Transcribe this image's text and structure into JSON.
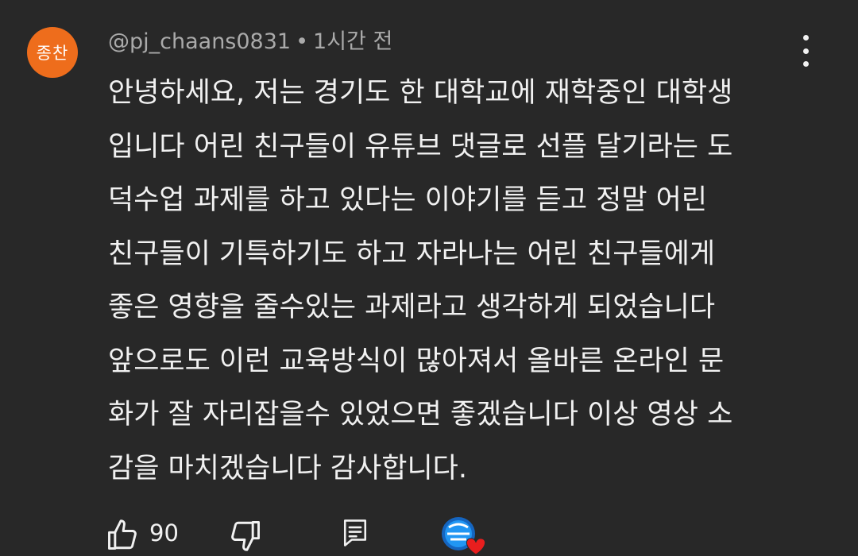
{
  "comment": {
    "avatar_text": "종찬",
    "author": "@pj_chaans0831",
    "separator": "•",
    "time": "1시간 전",
    "lines": [
      "안녕하세요, 저는 경기도 한 대학교에 재학중인 대학생",
      "입니다 어린 친구들이 유튜브 댓글로 선플 달기라는 도",
      "덕수업 과제를 하고 있다는 이야기를 듣고 정말 어린",
      "친구들이 기특하기도 하고 자라나는 어린 친구들에게",
      "좋은 영향을 줄수있는 과제라고 생각하게 되었습니다",
      "앞으로도 이런 교육방식이 많아져서 올바른 온라인 문",
      "화가 잘 자리잡을수 있었으면 좋겠습니다 이상 영상 소",
      "감을 마치겠습니다 감사합니다."
    ]
  },
  "actions": {
    "like_icon": "thumbs-up-icon",
    "like_count": "90",
    "dislike_icon": "thumbs-down-icon",
    "reply_icon": "reply-icon",
    "creator_heart_icon": "creator-heart-icon"
  },
  "colors": {
    "background": "#282828",
    "avatar": "#ee6d1c",
    "text": "#f1f1f1",
    "meta": "#aaaaaa",
    "heart": "#e81e1e"
  }
}
